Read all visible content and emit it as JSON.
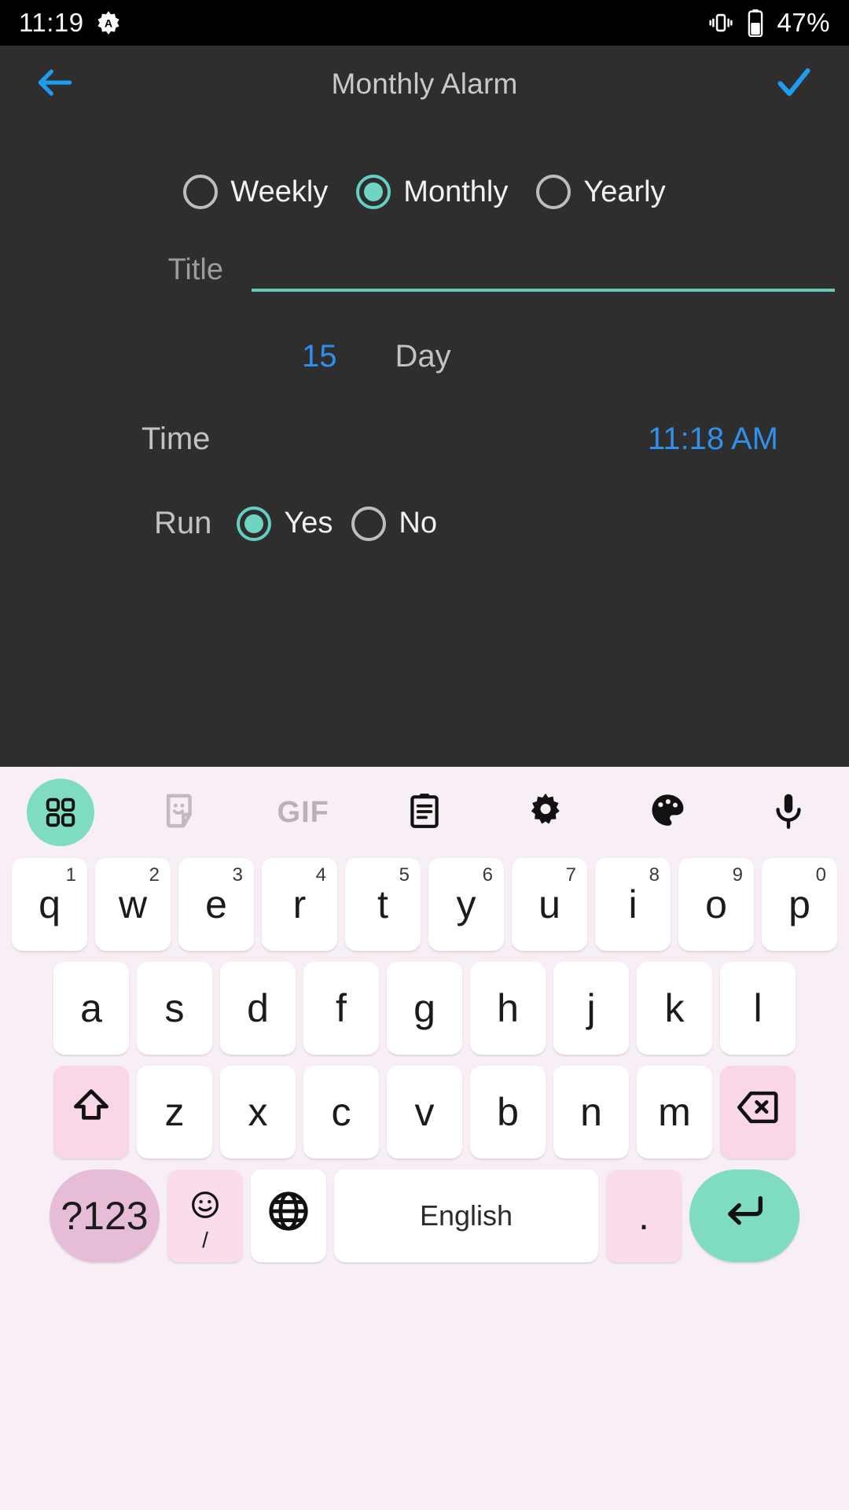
{
  "status_bar": {
    "time": "11:19",
    "badge_icon": "assistant-a-icon",
    "vibrate_icon": "vibrate-icon",
    "battery_icon": "battery-icon",
    "battery_level": "47%"
  },
  "app_bar": {
    "back_icon": "back-arrow-icon",
    "title": "Monthly Alarm",
    "confirm_icon": "check-icon"
  },
  "form": {
    "frequency": {
      "selected": "Monthly",
      "options": [
        {
          "label": "Weekly",
          "selected": false
        },
        {
          "label": "Monthly",
          "selected": true
        },
        {
          "label": "Yearly",
          "selected": false
        }
      ]
    },
    "title_field": {
      "label": "Title",
      "value": "",
      "placeholder": ""
    },
    "day_row": {
      "value": "15",
      "label": "Day"
    },
    "time_row": {
      "label": "Time",
      "value": "11:18 AM"
    },
    "run_row": {
      "label": "Run",
      "options": [
        {
          "label": "Yes",
          "selected": true
        },
        {
          "label": "No",
          "selected": false
        }
      ]
    }
  },
  "colors": {
    "accent_teal": "#6fd4c4",
    "accent_blue": "#2e90e8",
    "background": "#2e2e2e",
    "keyboard_bg": "#f8eef6"
  },
  "keyboard": {
    "toolbar": [
      {
        "icon": "apps-grid-icon",
        "active": true
      },
      {
        "icon": "sticker-icon",
        "active": false
      },
      {
        "icon": "gif-icon",
        "label": "GIF",
        "active": false
      },
      {
        "icon": "clipboard-icon",
        "active": false
      },
      {
        "icon": "gear-icon",
        "active": false
      },
      {
        "icon": "palette-icon",
        "active": false
      },
      {
        "icon": "microphone-icon",
        "active": false
      }
    ],
    "row1": [
      {
        "key": "q",
        "sup": "1"
      },
      {
        "key": "w",
        "sup": "2"
      },
      {
        "key": "e",
        "sup": "3"
      },
      {
        "key": "r",
        "sup": "4"
      },
      {
        "key": "t",
        "sup": "5"
      },
      {
        "key": "y",
        "sup": "6"
      },
      {
        "key": "u",
        "sup": "7"
      },
      {
        "key": "i",
        "sup": "8"
      },
      {
        "key": "o",
        "sup": "9"
      },
      {
        "key": "p",
        "sup": "0"
      }
    ],
    "row2": [
      "a",
      "s",
      "d",
      "f",
      "g",
      "h",
      "j",
      "k",
      "l"
    ],
    "row3": [
      "z",
      "x",
      "c",
      "v",
      "b",
      "n",
      "m"
    ],
    "shift_icon": "shift-up-icon",
    "backspace_icon": "backspace-icon",
    "symbols_key": "?123",
    "emoji_icon": "emoji-icon",
    "emoji_sub": "/",
    "globe_icon": "globe-icon",
    "space_label": "English",
    "period_key": ".",
    "enter_icon": "enter-return-icon"
  }
}
